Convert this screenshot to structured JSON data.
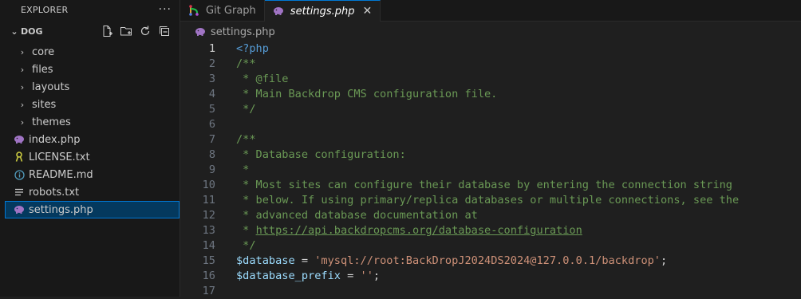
{
  "sidebar": {
    "header_title": "EXPLORER",
    "more_label": "···",
    "folder_name": "DOG",
    "tree": [
      {
        "label": "core"
      },
      {
        "label": "files"
      },
      {
        "label": "layouts"
      },
      {
        "label": "sites"
      },
      {
        "label": "themes"
      },
      {
        "label": "index.php"
      },
      {
        "label": "LICENSE.txt"
      },
      {
        "label": "README.md"
      },
      {
        "label": "robots.txt"
      },
      {
        "label": "settings.php"
      }
    ],
    "selected_item": "settings.php"
  },
  "tabs": [
    {
      "label": "Git Graph",
      "icon": "git-graph-icon"
    },
    {
      "label": "settings.php",
      "icon": "php-elephant-icon",
      "close": "✕"
    }
  ],
  "breadcrumb": {
    "label": "settings.php"
  },
  "editor": {
    "current_line": "1",
    "line_numbers": [
      "1",
      "2",
      "3",
      "4",
      "5",
      "6",
      "7",
      "8",
      "9",
      "10",
      "11",
      "12",
      "13",
      "14",
      "15",
      "16",
      "17"
    ],
    "code": {
      "l1": "<?php",
      "l2": "/**",
      "l3": " * @file",
      "l4": " * Main Backdrop CMS configuration file.",
      "l5": " */",
      "l7": "/**",
      "l8": " * Database configuration:",
      "l9": " *",
      "l10": " * Most sites can configure their database by entering the connection string",
      "l11": " * below. If using primary/replica databases or multiple connections, see the",
      "l12": " * advanced database documentation at",
      "l13_prefix": " * ",
      "l13_url": "https://api.backdropcms.org/database-configuration",
      "l14": " */",
      "l15_var": "$database",
      "l15_op": " = ",
      "l15_str": "'mysql://root:BackDropJ2024DS2024@127.0.0.1/backdrop'",
      "l15_end": ";",
      "l16_var": "$database_prefix",
      "l16_op": " = ",
      "l16_str": "''",
      "l16_end": ";"
    }
  },
  "colors": {
    "selection_bg": "#04395e",
    "accent": "#0078d4",
    "comment": "#6a9955",
    "string": "#ce9178",
    "variable": "#9cdcfe",
    "tag": "#569cd6"
  }
}
